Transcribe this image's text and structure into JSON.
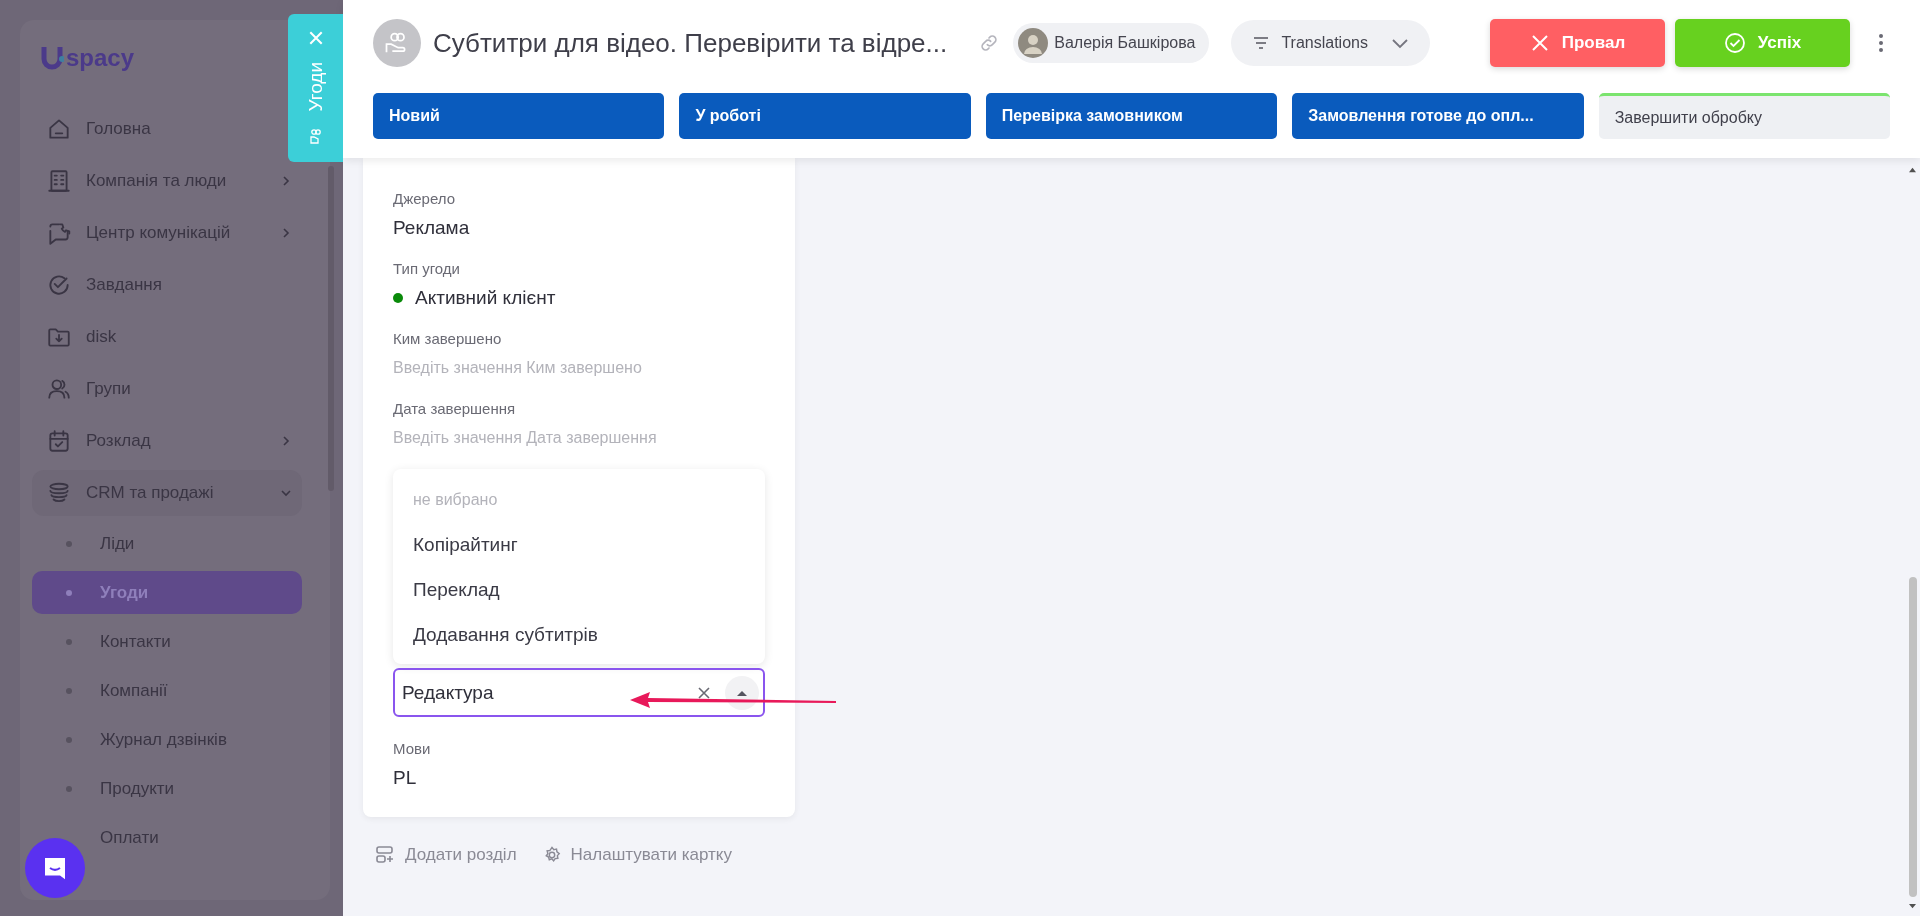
{
  "sidebar": {
    "logo": "spacy",
    "items": [
      {
        "label": "Головна",
        "selected": false
      },
      {
        "label": "Компанія та люди",
        "selected": false,
        "expanded": false
      },
      {
        "label": "Центр комунікацій",
        "selected": false,
        "expanded": false
      },
      {
        "label": "Завдання",
        "selected": false
      },
      {
        "label": "disk",
        "selected": false
      },
      {
        "label": "Групи",
        "selected": false
      },
      {
        "label": "Розклад",
        "selected": false,
        "expanded": false
      },
      {
        "label": "CRM та продажі",
        "selected": false,
        "expanded": true,
        "children": [
          {
            "label": "Ліди",
            "selected": false
          },
          {
            "label": "Угоди",
            "selected": true
          },
          {
            "label": "Контакти",
            "selected": false
          },
          {
            "label": "Компанії",
            "selected": false
          },
          {
            "label": "Журнал дзвінків",
            "selected": false
          },
          {
            "label": "Продукти",
            "selected": false
          },
          {
            "label": "Оплати",
            "selected": false
          }
        ]
      }
    ]
  },
  "entity_tab": {
    "label": "Угоди"
  },
  "header": {
    "title": "Субтитри для відео. Перевірити та відре...",
    "responsible": {
      "name": "Валерія Башкірова"
    },
    "pipeline": {
      "label": "Translations"
    },
    "buttons": [
      {
        "label": "Провал",
        "kind": "fail"
      },
      {
        "label": "Успіх",
        "kind": "success"
      }
    ]
  },
  "stages": [
    {
      "label": "Новий",
      "reached": true
    },
    {
      "label": "У роботі",
      "reached": true
    },
    {
      "label": "Перевірка замовником",
      "reached": true
    },
    {
      "label": "Замовлення готове до опл...",
      "reached": true
    },
    {
      "label": "Завершити обробку",
      "reached": false
    }
  ],
  "card": {
    "fields": [
      {
        "label": "Джерело",
        "value": "Реклама"
      },
      {
        "label": "Тип угоди",
        "value": "Активний клієнт",
        "color": "#0a8a0a"
      },
      {
        "label": "Ким завершено",
        "placeholder": "Введіть значення Ким завершено"
      },
      {
        "label": "Дата завершення",
        "placeholder": "Введіть значення Дата завершення"
      }
    ],
    "select": {
      "empty_option": "не вибрано",
      "options": [
        "Копірайтинг",
        "Переклад",
        "Додавання субтитрів"
      ],
      "value": "Редактура",
      "open": true
    },
    "fields_after": [
      {
        "label": "Мови",
        "value": "PL"
      }
    ]
  },
  "footer_actions": [
    {
      "label": "Додати розділ",
      "kind": "add"
    },
    {
      "label": "Налаштувати картку",
      "kind": "settings"
    }
  ]
}
